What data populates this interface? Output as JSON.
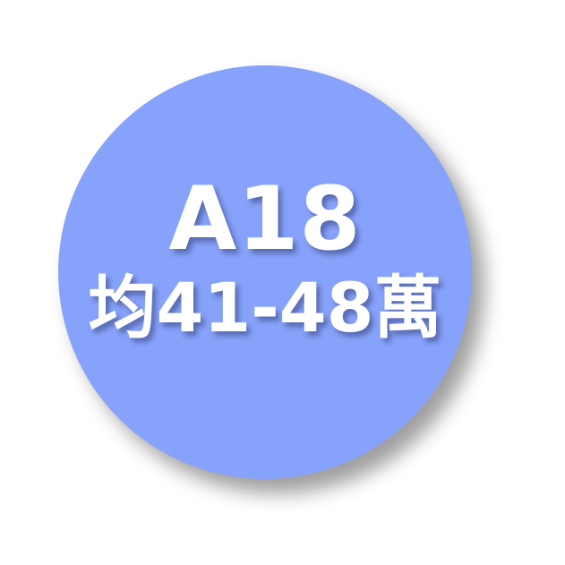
{
  "badge": {
    "line1": "A18",
    "line2": "均41-48萬",
    "fill_color": "#87a2fa",
    "text_color": "#ffffff"
  }
}
